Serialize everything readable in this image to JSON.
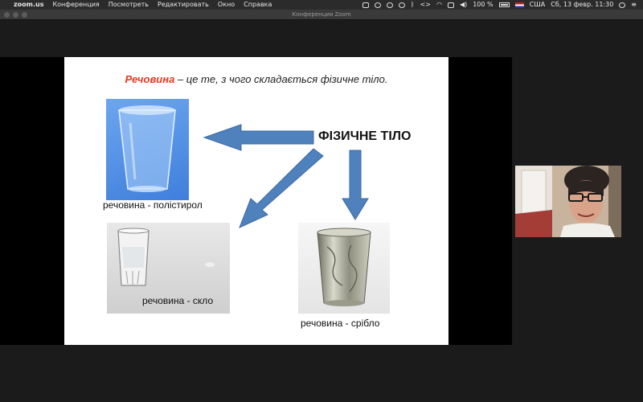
{
  "menubar": {
    "apple": "",
    "app_name": "zoom.us",
    "menus": [
      "Конференция",
      "Посмотреть",
      "Редактировать",
      "Окно",
      "Справка"
    ],
    "battery": "100 %",
    "input_source": "США",
    "datetime": "Сб, 13 февр.  11:30"
  },
  "window": {
    "title": "Конференция Zoom"
  },
  "slide": {
    "title_accent": "Речовина",
    "title_rest": " – це те, з чого складається фізичне тіло.",
    "heading": "ФІЗИЧНЕ ТІЛО",
    "captions": {
      "cup": "речовина - полістирол",
      "glass": "речовина - скло",
      "silver": "речовина - срібло"
    },
    "accent_color": "#e33a1e",
    "arrow_color": "#4f81bd"
  }
}
